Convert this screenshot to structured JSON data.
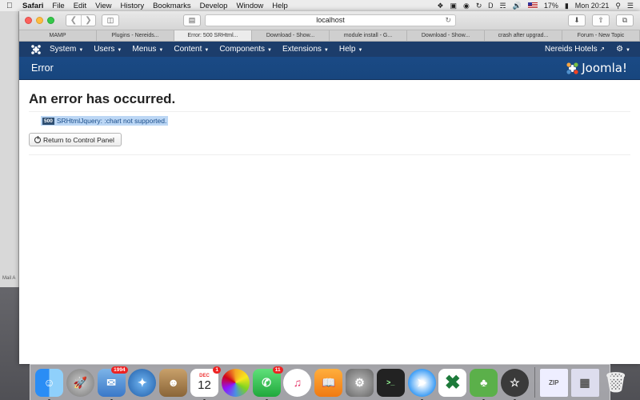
{
  "menubar": {
    "app": "Safari",
    "items": [
      "File",
      "Edit",
      "View",
      "History",
      "Bookmarks",
      "Develop",
      "Window",
      "Help"
    ],
    "battery": "17%",
    "clock": "Mon 20:21"
  },
  "bgwin": {
    "label": "Mail A"
  },
  "browser": {
    "url": "localhost",
    "tabs": [
      {
        "label": "MAMP"
      },
      {
        "label": "Plugins - Nereids..."
      },
      {
        "label": "Error: 500 SRHtml..."
      },
      {
        "label": "Download - Show..."
      },
      {
        "label": "module install - G..."
      },
      {
        "label": "Download - Show..."
      },
      {
        "label": "crash after upgrad..."
      },
      {
        "label": "Forum - New Topic"
      }
    ]
  },
  "joomla": {
    "nav": [
      {
        "label": "System"
      },
      {
        "label": "Users"
      },
      {
        "label": "Menus"
      },
      {
        "label": "Content"
      },
      {
        "label": "Components"
      },
      {
        "label": "Extensions"
      },
      {
        "label": "Help"
      }
    ],
    "site_link": "Nereids Hotels",
    "page_title": "Error",
    "brand": "Joomla!",
    "brand_color": "#1a4a85"
  },
  "error": {
    "heading": "An error has occurred.",
    "code": "500",
    "message": "SRHtmlJquery: :chart not supported.",
    "button": "Return to Control Panel"
  },
  "dock": {
    "mail_badge": "1994",
    "calendar_month": "DEC",
    "calendar_day": "12",
    "calendar_badge": "1",
    "messages_badge": "11"
  }
}
